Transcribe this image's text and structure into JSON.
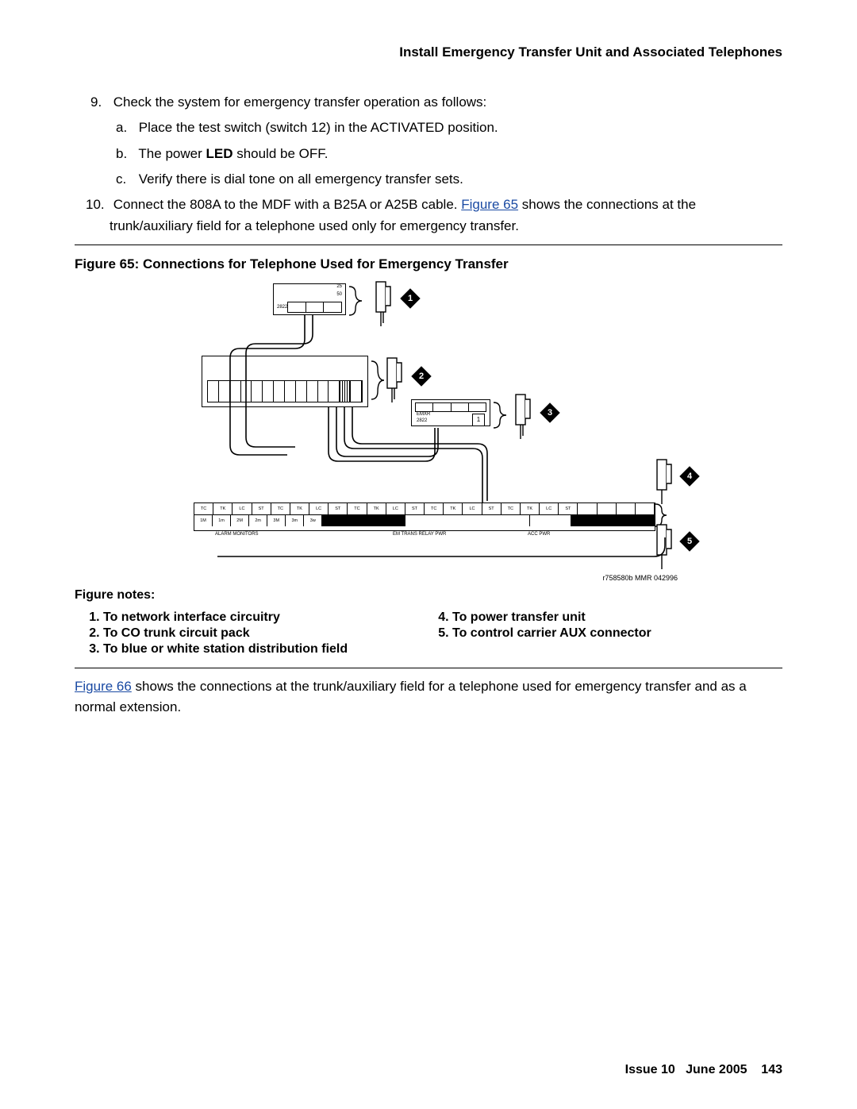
{
  "header": "Install Emergency Transfer Unit and Associated Telephones",
  "step9": {
    "num": "9.",
    "text": "Check the system for emergency transfer operation as follows:",
    "a": {
      "lt": "a.",
      "text_before": "Place the test switch (switch 12) in the ACTIVATED position."
    },
    "b": {
      "lt": "b.",
      "text_before": "The power ",
      "bold": "LED",
      "text_after": " should be OFF."
    },
    "c": {
      "lt": "c.",
      "text": "Verify there is dial tone on all emergency transfer sets."
    }
  },
  "step10": {
    "num": "10.",
    "pre": "Connect the 808A to the MDF with a B25A or A25B cable. ",
    "link": "Figure 65",
    "post": " shows the connections at the trunk/auxiliary field for a telephone used only for emergency transfer."
  },
  "figure": {
    "title": "Figure 65: Connections for Telephone Used for Emergency Transfer",
    "top25": "25",
    "top50": "50",
    "top2822": "2822",
    "mid_emxr": "EMXR",
    "mid_2822": "2822",
    "mid_1": "1",
    "bottom_labels": {
      "alarm": "ALARM  MONITORS",
      "em": "EM TRANS RELAY PWR",
      "acc": "ACC PWR"
    },
    "row2": [
      "1M",
      "1m",
      "2M",
      "2m",
      "3M",
      "3m",
      "3w"
    ],
    "row1": [
      "TC",
      "TK",
      "LC",
      "ST",
      "TC",
      "TK",
      "LC",
      "ST",
      "TC",
      "TK",
      "LC",
      "ST",
      "TC",
      "TK",
      "LC",
      "ST",
      "TC",
      "TK",
      "LC",
      "ST"
    ],
    "small_row": [
      "",
      "",
      "",
      "",
      "",
      "",
      "",
      "",
      "",
      "",
      "",
      "",
      "1"
    ],
    "callouts": [
      "1",
      "2",
      "3",
      "4",
      "5"
    ],
    "id": "r758580b MMR 042996"
  },
  "notes": {
    "title": "Figure notes:",
    "left": [
      "To network interface circuitry",
      "To CO trunk circuit pack",
      "To blue or white station distribution field"
    ],
    "right": [
      "To power transfer unit",
      "To control carrier AUX connector"
    ]
  },
  "after": {
    "link": "Figure 66",
    "text": " shows the connections at the trunk/auxiliary field for a telephone used for emergency transfer and as a normal extension."
  },
  "footer": {
    "issue": "Issue 10",
    "date": "June 2005",
    "page": "143"
  }
}
